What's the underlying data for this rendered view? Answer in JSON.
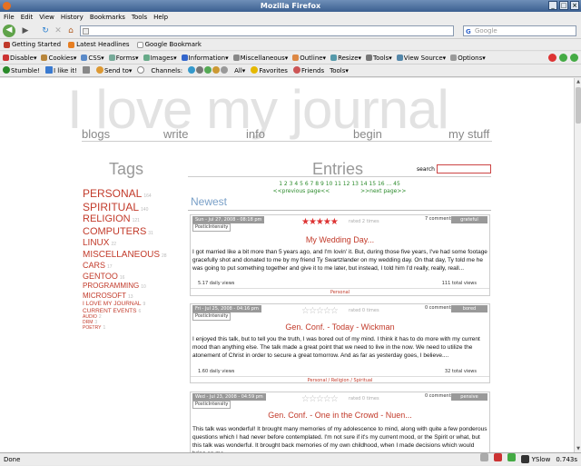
{
  "window": {
    "title": "Mozilla Firefox",
    "min": "_",
    "max": "□",
    "close": "×"
  },
  "menu": [
    "File",
    "Edit",
    "View",
    "History",
    "Bookmarks",
    "Tools",
    "Help"
  ],
  "nav": {
    "back": "◀",
    "forward": "▶",
    "reload": "↻",
    "stop": "✕",
    "home": "⌂",
    "url": "",
    "search_placeholder": "Google",
    "search_engine": "G"
  },
  "bookmarks": [
    {
      "label": "Getting Started",
      "color": "#c0392b"
    },
    {
      "label": "Latest Headlines",
      "color": "#e67e22"
    },
    {
      "label": "Google Bookmark",
      "color": "#3366cc"
    }
  ],
  "devtoolbar": [
    "Disable▾",
    "Cookies▾",
    "CSS▾",
    "Forms▾",
    "Images▾",
    "Information▾",
    "Miscellaneous▾",
    "Outline▾",
    "Resize▾",
    "Tools▾",
    "View Source▾",
    "Options▾"
  ],
  "stumbletoolbar": {
    "stumble": "Stumble!",
    "ilike": "I like it!",
    "sendto": "Send to▾",
    "channels": "Channels:",
    "all": "All▾",
    "favorites": "Favorites",
    "friends": "Friends",
    "tools": "Tools▾"
  },
  "status": {
    "text": "Done",
    "yslow": "YSlow",
    "time": "0.743s"
  },
  "page": {
    "hero": "I love my journal",
    "topnav": [
      "blogs",
      "write",
      "info",
      "begin",
      "my stuff"
    ],
    "tags_heading": "Tags",
    "tags": [
      {
        "name": "Personal",
        "count": "164",
        "size": 12
      },
      {
        "name": "Spiritual",
        "count": "140",
        "size": 12
      },
      {
        "name": "Religion",
        "count": "121",
        "size": 11
      },
      {
        "name": "Computers",
        "count": "31",
        "size": 11
      },
      {
        "name": "Linux",
        "count": "22",
        "size": 10
      },
      {
        "name": "Miscellaneous",
        "count": "28",
        "size": 10
      },
      {
        "name": "Cars",
        "count": "17",
        "size": 9
      },
      {
        "name": "Gentoo",
        "count": "16",
        "size": 9
      },
      {
        "name": "Programming",
        "count": "10",
        "size": 8
      },
      {
        "name": "Microsoft",
        "count": "13",
        "size": 8
      },
      {
        "name": "I Love My Journal",
        "count": "9",
        "size": 6.5
      },
      {
        "name": "Current Events",
        "count": "6",
        "size": 6.5
      },
      {
        "name": "Audio",
        "count": "2",
        "size": 5
      },
      {
        "name": "DRM",
        "count": "3",
        "size": 5
      },
      {
        "name": "Poetry",
        "count": "1",
        "size": 5
      }
    ],
    "entries_heading": "Entries",
    "search_label": "search",
    "pages_line": "1 2 3 4 5 6 7 8 9 10 11 12 13 14 15 16 ... 45",
    "pages_current": "2",
    "pages_prev": "<<previous page<<",
    "pages_next": ">>next page>>",
    "newest_heading": "Newest",
    "entries": [
      {
        "date": "Sun - Jul 27, 2008 - 08:18 pm",
        "pi": "PosticIntensity",
        "stars": "★★★★★",
        "rated": "rated 2 times",
        "comments": "7 comments",
        "mood": "grateful",
        "title": "My Wedding Day...",
        "body": "I got married like a bit more than 5 years ago, and I'm lovin' it. But, during those five years, I've had some footage gracefully shot and donated to me by my friend Ty Swartzlander on my wedding day. On that day, Ty told me he was going to put something together and give it to me later, but instead, I told him I'd really, really, reall...",
        "views": "5.17 daily views",
        "total": "111 total views",
        "cats": "Personal"
      },
      {
        "date": "Fri - Jul 25, 2008 - 04:16 pm",
        "pi": "PosticIntensity",
        "stars": "☆☆☆☆☆",
        "rated": "rated 0 times",
        "comments": "0 comments",
        "mood": "bored",
        "title": "Gen. Conf. - Today - Wickman",
        "body": "I enjoyed this talk, but to tell you the truth, I was bored out of my mind. I think it has to do more with my current mood than anything else. The talk made a great point that we need to live in the now.  We need to utilize the atonement of Christ in order to secure a great tomorrow. And as far as yesterday goes, I believe....",
        "views": "1.60 daily views",
        "total": "32 total views",
        "cats": "Personal / Religion / Spiritual"
      },
      {
        "date": "Wed - Jul 23, 2008 - 04:59 pm",
        "pi": "PosticIntensity",
        "stars": "☆☆☆☆☆",
        "rated": "rated 0 times",
        "comments": "0 comments",
        "mood": "pensive",
        "title": "Gen. Conf. - One in the Crowd - Nuen...",
        "body": "This talk was wonderful!  It brought many memories of my adolescence to mind, along with quite a few ponderous questions which I had never before contemplated. I'm not sure if it's my current mood, or the Spirit or what, but this talk was wonderful. It brought back memories of my own childhood, when I made decisions which would bring on me...",
        "views": "",
        "total": "",
        "cats": ""
      }
    ]
  }
}
